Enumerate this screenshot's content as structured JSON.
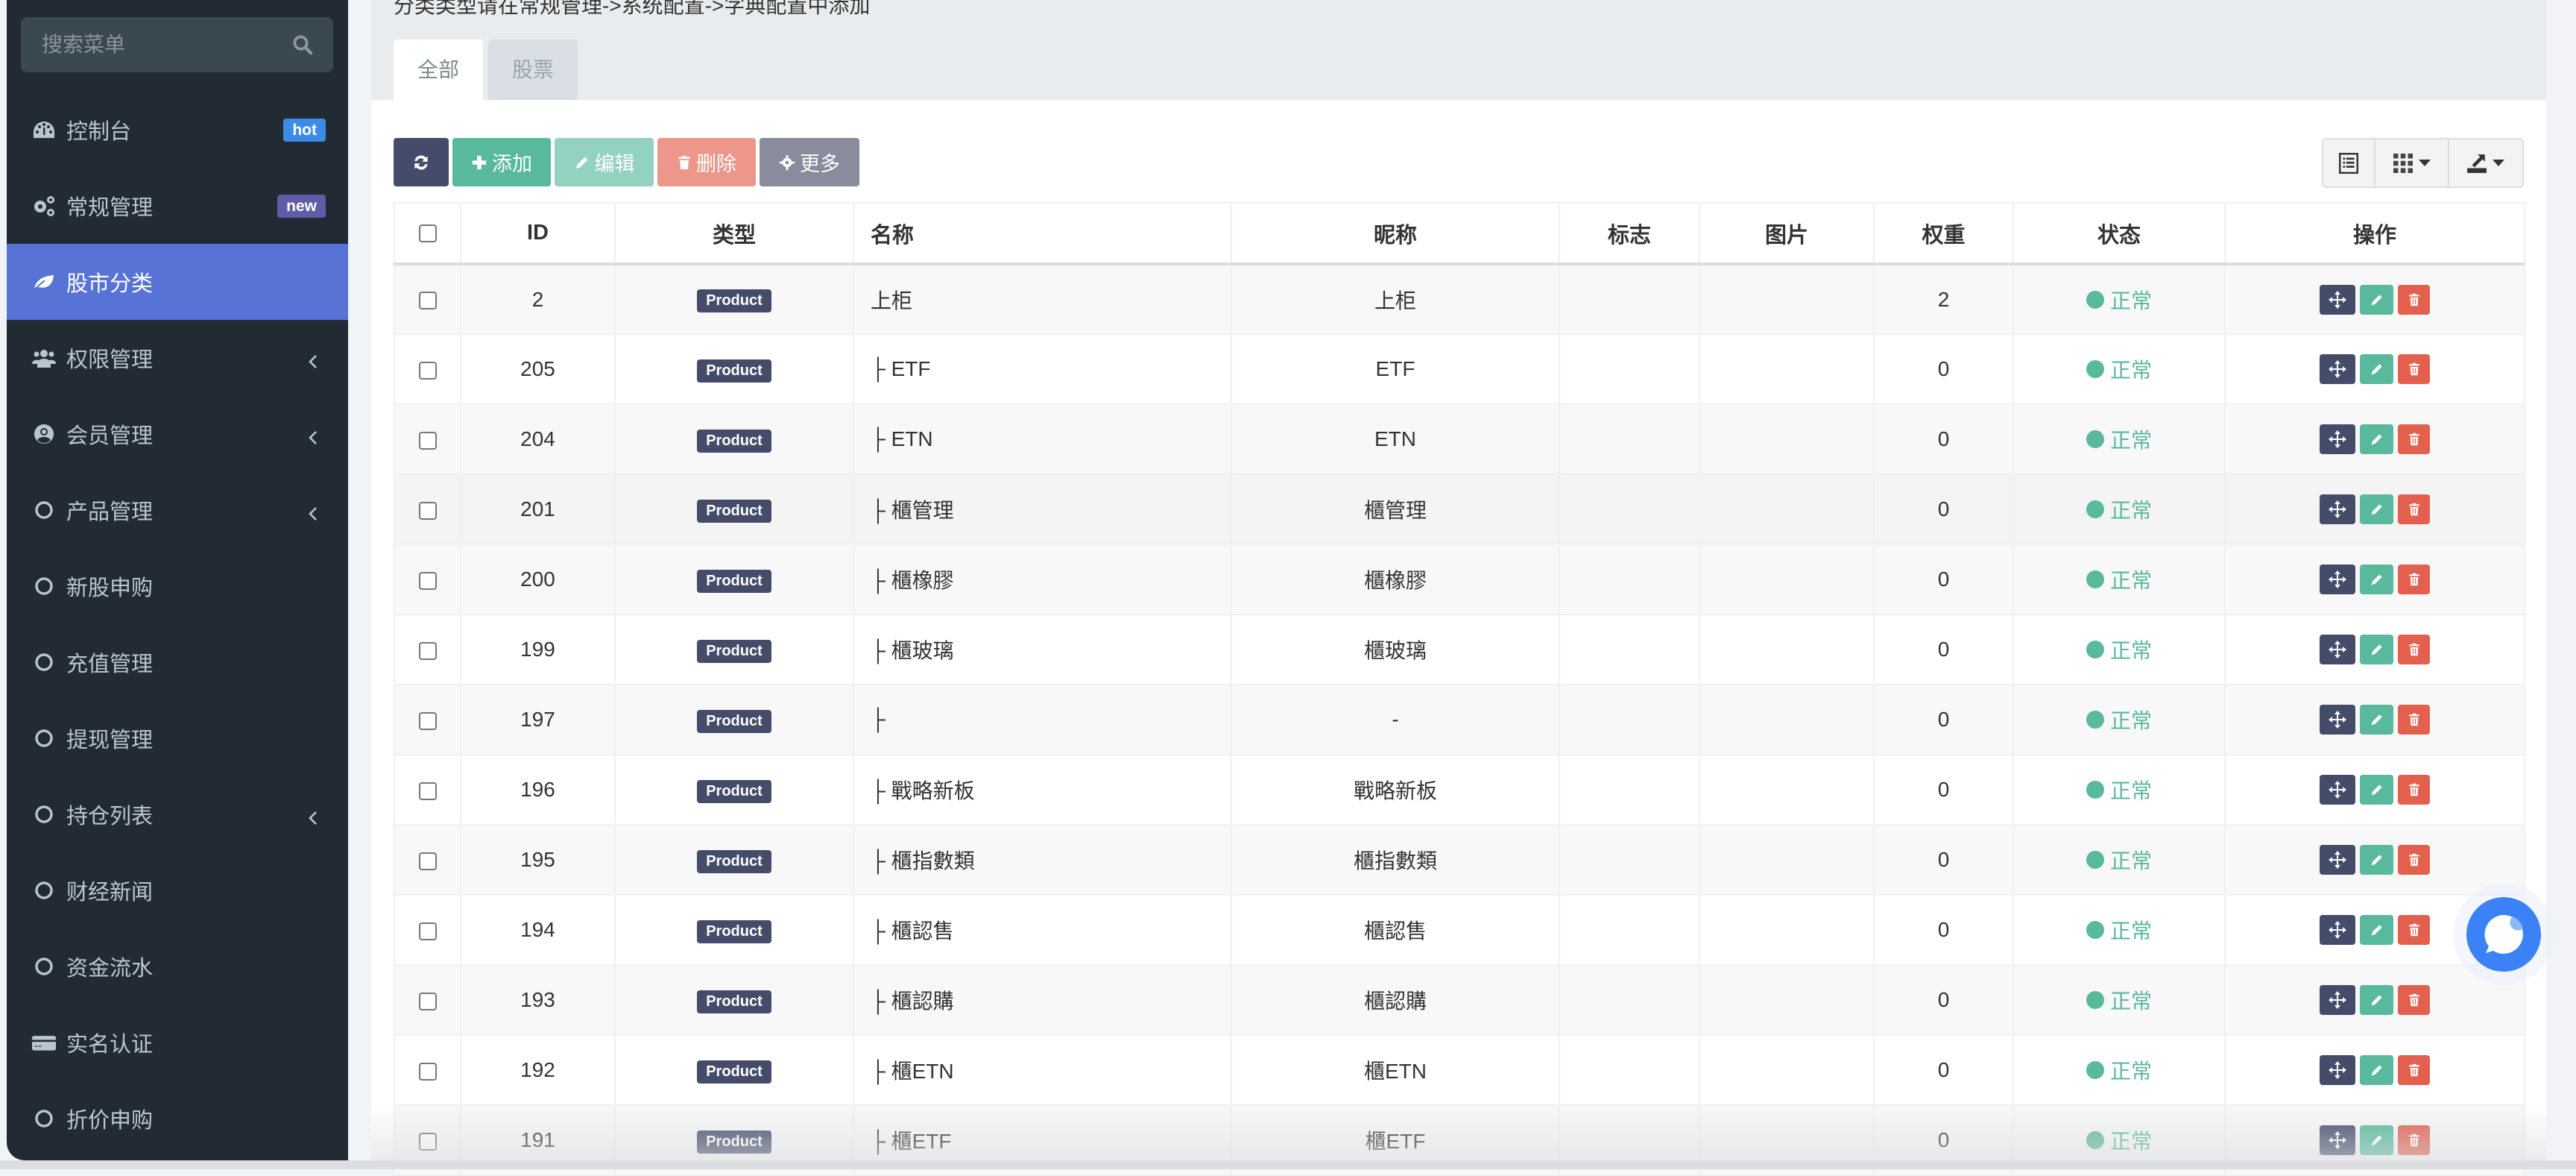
{
  "sidebar": {
    "search_placeholder": "搜索菜单",
    "items": [
      {
        "label": "控制台",
        "icon": "dashboard-icon",
        "badge": "hot"
      },
      {
        "label": "常规管理",
        "icon": "cogs-icon",
        "badge": "new"
      },
      {
        "label": "股市分类",
        "icon": "leaf-icon",
        "active": true
      },
      {
        "label": "权限管理",
        "icon": "users-icon",
        "has_children": true
      },
      {
        "label": "会员管理",
        "icon": "user-circle-icon",
        "has_children": true
      },
      {
        "label": "产品管理",
        "icon": "circle-icon",
        "has_children": true
      },
      {
        "label": "新股申购",
        "icon": "circle-icon"
      },
      {
        "label": "充值管理",
        "icon": "circle-icon"
      },
      {
        "label": "提现管理",
        "icon": "circle-icon"
      },
      {
        "label": "持仓列表",
        "icon": "circle-icon",
        "has_children": true
      },
      {
        "label": "财经新闻",
        "icon": "circle-icon"
      },
      {
        "label": "资金流水",
        "icon": "circle-icon"
      },
      {
        "label": "实名认证",
        "icon": "credit-card-icon"
      },
      {
        "label": "折价申购",
        "icon": "circle-icon"
      }
    ]
  },
  "main": {
    "tip": "分类类型请在常规管理->系统配置->字典配置中添加",
    "tabs": [
      {
        "label": "全部",
        "active": true
      },
      {
        "label": "股票",
        "active": false
      }
    ],
    "toolbar": {
      "add": "添加",
      "edit": "编辑",
      "delete": "删除",
      "more": "更多"
    },
    "table": {
      "columns": [
        "ID",
        "类型",
        "名称",
        "昵称",
        "标志",
        "图片",
        "权重",
        "状态",
        "操作"
      ],
      "rows": [
        {
          "id": "2",
          "type": "Product",
          "name": "上柜",
          "nickname": "上柜",
          "flag": "",
          "image": "",
          "weight": "2",
          "status": "正常"
        },
        {
          "id": "205",
          "type": "Product",
          "name": "├ ETF",
          "nickname": "ETF",
          "flag": "",
          "image": "",
          "weight": "0",
          "status": "正常"
        },
        {
          "id": "204",
          "type": "Product",
          "name": "├ ETN",
          "nickname": "ETN",
          "flag": "",
          "image": "",
          "weight": "0",
          "status": "正常"
        },
        {
          "id": "201",
          "type": "Product",
          "name": "├ 櫃管理",
          "nickname": "櫃管理",
          "flag": "",
          "image": "",
          "weight": "0",
          "status": "正常"
        },
        {
          "id": "200",
          "type": "Product",
          "name": "├ 櫃橡膠",
          "nickname": "櫃橡膠",
          "flag": "",
          "image": "",
          "weight": "0",
          "status": "正常"
        },
        {
          "id": "199",
          "type": "Product",
          "name": "├ 櫃玻璃",
          "nickname": "櫃玻璃",
          "flag": "",
          "image": "",
          "weight": "0",
          "status": "正常"
        },
        {
          "id": "197",
          "type": "Product",
          "name": "├",
          "nickname": "-",
          "flag": "",
          "image": "",
          "weight": "0",
          "status": "正常"
        },
        {
          "id": "196",
          "type": "Product",
          "name": "├ 戰略新板",
          "nickname": "戰略新板",
          "flag": "",
          "image": "",
          "weight": "0",
          "status": "正常"
        },
        {
          "id": "195",
          "type": "Product",
          "name": "├ 櫃指數類",
          "nickname": "櫃指數類",
          "flag": "",
          "image": "",
          "weight": "0",
          "status": "正常"
        },
        {
          "id": "194",
          "type": "Product",
          "name": "├ 櫃認售",
          "nickname": "櫃認售",
          "flag": "",
          "image": "",
          "weight": "0",
          "status": "正常"
        },
        {
          "id": "193",
          "type": "Product",
          "name": "├ 櫃認購",
          "nickname": "櫃認購",
          "flag": "",
          "image": "",
          "weight": "0",
          "status": "正常"
        },
        {
          "id": "192",
          "type": "Product",
          "name": "├ 櫃ETN",
          "nickname": "櫃ETN",
          "flag": "",
          "image": "",
          "weight": "0",
          "status": "正常"
        },
        {
          "id": "191",
          "type": "Product",
          "name": "├ 櫃ETF",
          "nickname": "櫃ETF",
          "flag": "",
          "image": "",
          "weight": "0",
          "status": "正常"
        }
      ]
    }
  },
  "colors": {
    "sidebar_bg": "#222b33",
    "active_menu": "#5673d5",
    "primary_dark": "#444c69",
    "success": "#58b99c",
    "danger": "#e3604e",
    "badge_hot": "#3c8ce7",
    "badge_new": "#605ca8",
    "chat": "#3b82f6"
  }
}
